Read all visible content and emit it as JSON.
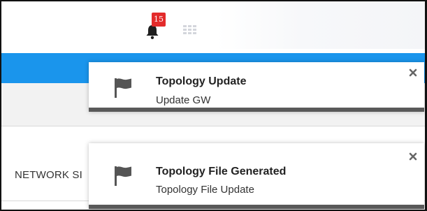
{
  "header": {
    "notification_count": "15"
  },
  "table": {
    "column_header": "NETWORK SI"
  },
  "notifications": [
    {
      "title": "Topology Update",
      "message": "Update GW"
    },
    {
      "title": "Topology File Generated",
      "message": "Topology File Update"
    }
  ],
  "icons": {
    "bell": "bell-icon",
    "grid": "grid-icon",
    "flag": "flag-icon",
    "close": "close-icon"
  },
  "colors": {
    "accent_blue": "#1a95ec",
    "badge_red": "#e32b2b",
    "toast_bar": "#595959"
  }
}
